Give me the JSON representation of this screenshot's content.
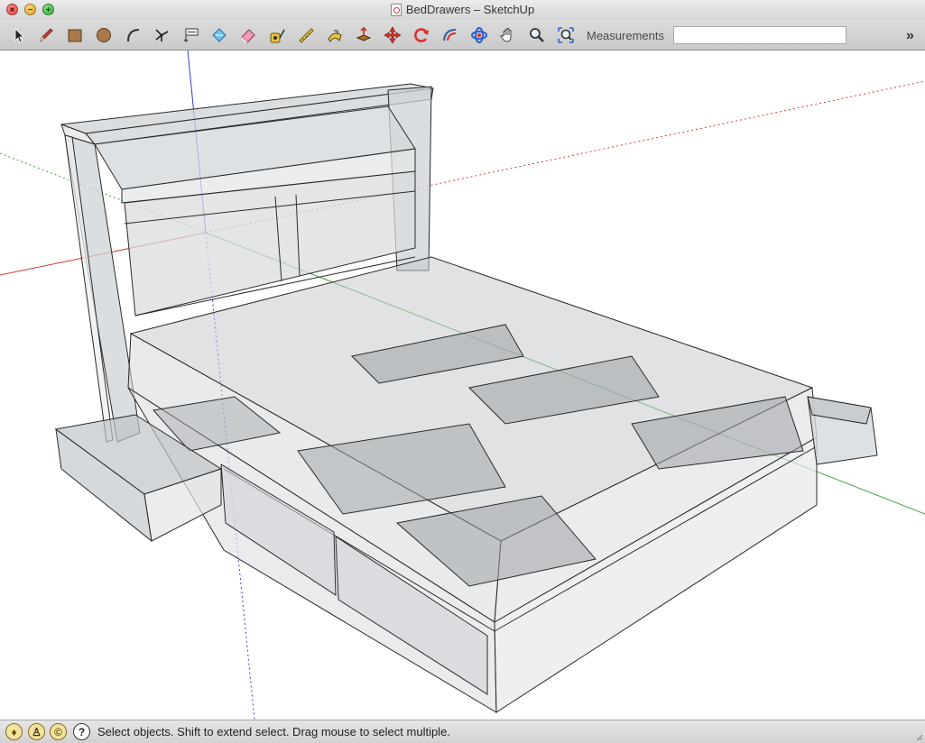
{
  "window": {
    "title": "BedDrawers – SketchUp"
  },
  "toolbar": {
    "tools": [
      "select-tool",
      "pencil-tool",
      "rectangle-tool",
      "circle-tool",
      "arc-tool",
      "axes-tool",
      "text-tool",
      "paint-bucket-tool",
      "eraser-tool",
      "tape-measure-tool",
      "dimension-tool",
      "follow-me-tool",
      "push-pull-tool",
      "move-tool",
      "rotate-tool",
      "offset-tool",
      "orbit-tool",
      "pan-tool",
      "zoom-tool",
      "zoom-extents-tool"
    ],
    "measurements_label": "Measurements",
    "measurements_value": ""
  },
  "statusbar": {
    "hint": "Select objects. Shift to extend select. Drag mouse to select multiple."
  },
  "colors": {
    "axis_red": "#d23a3a",
    "axis_green": "#3aa23a",
    "axis_blue": "#3a3ad2",
    "model_fill": "#cfd3d6",
    "model_dark": "#a9adb0"
  }
}
